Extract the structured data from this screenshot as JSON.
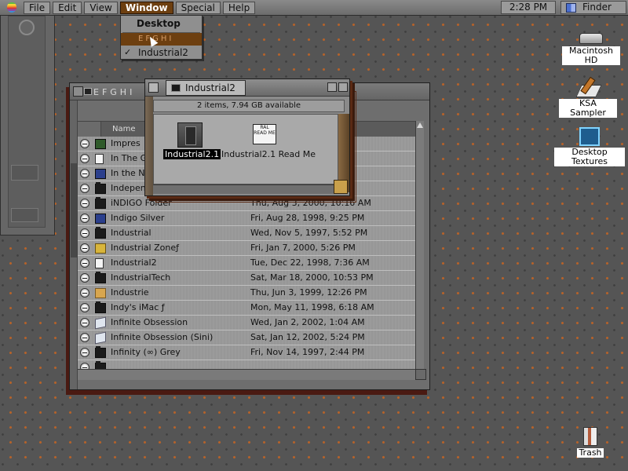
{
  "menubar": {
    "apple_icon": "apple-rainbow-icon",
    "items": [
      "File",
      "Edit",
      "View",
      "Window",
      "Special",
      "Help"
    ],
    "active_item": "Window",
    "clock": "2:28 PM",
    "app_name": "Finder"
  },
  "window_menu": {
    "desktop": "Desktop",
    "efghi": "EFGHI",
    "industrial": "Industrial2",
    "checked": "Industrial2"
  },
  "efghi_window": {
    "title": "EFGHI",
    "column_name": "Name",
    "rows": [
      {
        "name": "Impres",
        "date": "",
        "icon": "green"
      },
      {
        "name": "In The G",
        "date": "",
        "icon": "folder"
      },
      {
        "name": "In the N",
        "date": "",
        "icon": "blue"
      },
      {
        "name": "Indepen",
        "date": "",
        "icon": "folder"
      },
      {
        "name": "iNDIGO Folder",
        "date": "Thu, Aug 3, 2000, 10:16 AM",
        "icon": "folder"
      },
      {
        "name": "Indigo Silver",
        "date": "Fri, Aug 28, 1998, 9:25 PM",
        "icon": "blue"
      },
      {
        "name": "Industrial",
        "date": "Wed, Nov 5, 1997, 5:52 PM",
        "icon": "folder"
      },
      {
        "name": "Industrial Zoneƒ",
        "date": "Fri, Jan 7, 2000, 5:26 PM",
        "icon": "yellow"
      },
      {
        "name": "Industrial2",
        "date": "Tue, Dec 22, 1998, 7:36 AM",
        "icon": "doc"
      },
      {
        "name": "IndustrialTech",
        "date": "Sat, Mar 18, 2000, 10:53 PM",
        "icon": "folder"
      },
      {
        "name": "Industrie",
        "date": "Thu, Jun 3, 1999, 12:26 PM",
        "icon": "tan"
      },
      {
        "name": "Indy's iMac ƒ",
        "date": "Mon, May 11, 1998, 6:18 AM",
        "icon": "folder"
      },
      {
        "name": "Infinite Obsession",
        "date": "Wed, Jan 2, 2002, 1:04 AM",
        "icon": "white"
      },
      {
        "name": "Infinite Obsession (Sini)",
        "date": "Sat, Jan 12, 2002, 5:24 PM",
        "icon": "white"
      },
      {
        "name": "Infinity (∞) Grey",
        "date": "Fri, Nov 14, 1997, 2:44 PM",
        "icon": "folder"
      },
      {
        "name": "",
        "date": "",
        "icon": "folder"
      }
    ]
  },
  "industrial_window": {
    "title": "Industrial2",
    "info": "2 items, 7.94 GB available",
    "files": [
      {
        "name": "Industrial2.1",
        "selected": true
      },
      {
        "name": "Industrial2.1 Read Me",
        "selected": false
      }
    ],
    "readme_icon_text": [
      "RAL",
      "READ ME"
    ]
  },
  "desktop_icons": [
    {
      "name": "Macintosh HD",
      "icon": "hard-disk-icon"
    },
    {
      "name": "KSA Sampler",
      "icon": "ksa-sampler-icon"
    },
    {
      "name": "Desktop Textures",
      "icon": "desktop-textures-icon"
    },
    {
      "name": "Trash",
      "icon": "trash-icon"
    }
  ]
}
